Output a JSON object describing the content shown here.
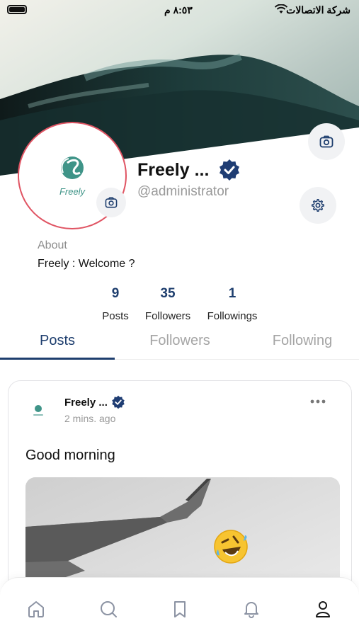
{
  "status_bar": {
    "time": "٨:٥٣ م",
    "carrier": "شركة الاتصالات"
  },
  "profile": {
    "avatar_logo_text": "Freely",
    "name": "Freely ...",
    "handle": "@administrator",
    "about_label": "About",
    "about_text": "Freely : Welcome ?",
    "stats": [
      {
        "value": "9",
        "label": "Posts"
      },
      {
        "value": "35",
        "label": "Followers"
      },
      {
        "value": "1",
        "label": "Followings"
      }
    ]
  },
  "tabs": [
    {
      "label": "Posts",
      "active": true
    },
    {
      "label": "Followers",
      "active": false
    },
    {
      "label": "Following",
      "active": false
    }
  ],
  "post": {
    "author": "Freely ...",
    "time": "2 mins. ago",
    "text": "Good morning",
    "menu_icon": "more-horizontal-icon"
  },
  "bottom_nav": [
    {
      "icon": "home-icon"
    },
    {
      "icon": "search-icon"
    },
    {
      "icon": "bookmark-icon"
    },
    {
      "icon": "bell-icon"
    },
    {
      "icon": "profile-icon"
    }
  ],
  "colors": {
    "accent": "#1e3e6e",
    "avatar_ring": "#e05463",
    "verified": "#1f3d73"
  }
}
